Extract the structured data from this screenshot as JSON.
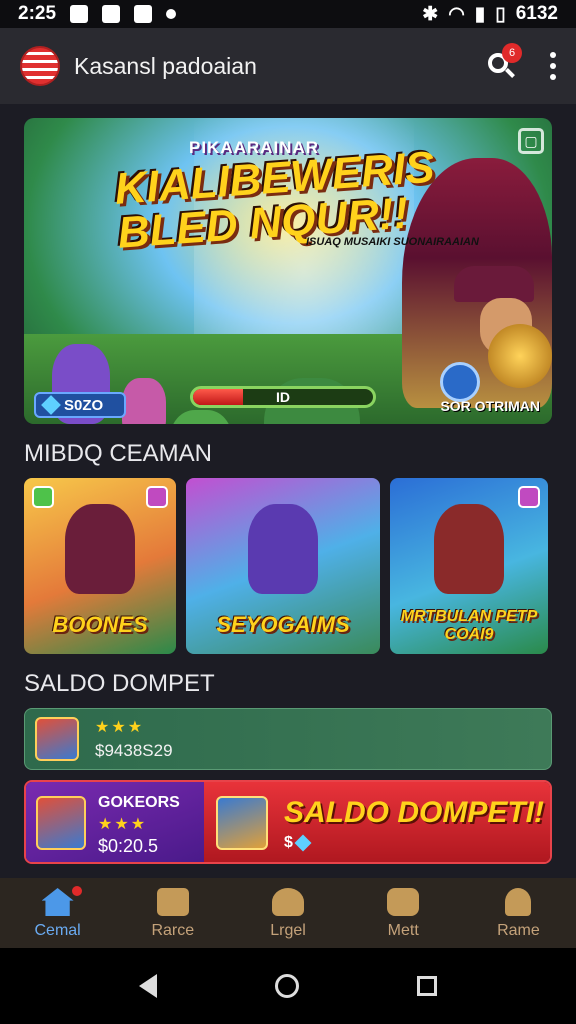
{
  "status_bar": {
    "time": "2:25",
    "battery_time": "6132"
  },
  "app_bar": {
    "title": "Kasansl padoaian",
    "notification_count": "6"
  },
  "hero": {
    "subtitle": "PIKAARAINAR",
    "title": "KIALIBEWERIS BLED NQUR!!",
    "tagline": "ISUAQ MUSAIKI SUONAIRAAIAN",
    "chip_value": "S0ZO",
    "progress_label": "ID",
    "progress_fraction": 0.28,
    "brand": "SOR OTRIMAN"
  },
  "section_games": {
    "title": "MIBDQ CEAMAN"
  },
  "games": [
    {
      "label": "BOONES"
    },
    {
      "label": "SEYOGAIMS"
    },
    {
      "label": "MRTBULAN PETP COAI9"
    }
  ],
  "section_wallet": {
    "title": "SALDO DOMPET"
  },
  "wallet_card_1": {
    "stars": "★★★",
    "amount": "$9438S29"
  },
  "wallet_card_2": {
    "name": "GOKEORS",
    "stars": "★★★",
    "amount": "$0:20.5",
    "title": "SALDO DOMPETI!",
    "small": "$"
  },
  "bottom_nav": [
    {
      "label": "Cemal"
    },
    {
      "label": "Rarce"
    },
    {
      "label": "Lrgel"
    },
    {
      "label": "Mett"
    },
    {
      "label": "Rame"
    }
  ]
}
